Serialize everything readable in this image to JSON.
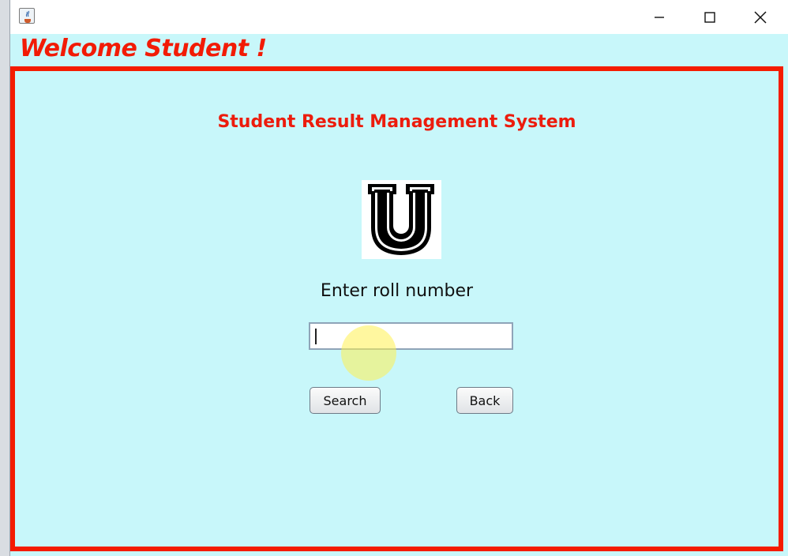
{
  "window": {
    "welcome_text": "Welcome Student !",
    "controls": [
      "minimize-icon",
      "maximize-icon",
      "close-icon"
    ]
  },
  "main": {
    "title": "Student Result Management System",
    "logo_letter": "U",
    "prompt": "Enter roll number",
    "roll_input": {
      "value": "",
      "placeholder": ""
    },
    "buttons": {
      "search": "Search",
      "back": "Back"
    }
  },
  "colors": {
    "background": "#c8f7fa",
    "accent_red": "#f41c00",
    "title_red": "#ec1c0d"
  }
}
